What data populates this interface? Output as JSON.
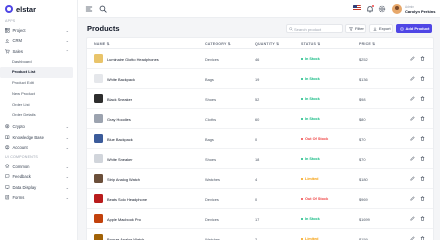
{
  "brand": {
    "name": "elstar"
  },
  "sidebar": {
    "apps_title": "APPS",
    "ui_title": "UI COMPONENTS",
    "items": [
      {
        "label": "Project",
        "icon": "grid-icon"
      },
      {
        "label": "CRM",
        "icon": "users-icon"
      },
      {
        "label": "Sales",
        "icon": "cart-icon"
      }
    ],
    "sales_sub": [
      "Dashboard",
      "Product List",
      "Product Edit",
      "New Product",
      "Order List",
      "Order Details"
    ],
    "more_items": [
      {
        "label": "Crypto",
        "icon": "crypto-icon"
      },
      {
        "label": "Knowledge Base",
        "icon": "book-icon"
      },
      {
        "label": "Account",
        "icon": "account-icon"
      }
    ],
    "ui_items": [
      {
        "label": "Common",
        "icon": "layers-icon"
      },
      {
        "label": "Feedback",
        "icon": "feedback-icon"
      },
      {
        "label": "Data Display",
        "icon": "display-icon"
      },
      {
        "label": "Forms",
        "icon": "forms-icon"
      }
    ]
  },
  "topbar": {
    "user_role": "Admin",
    "user_name": "Carolyn Perkins"
  },
  "page": {
    "title": "Products",
    "search_placeholder": "Search product",
    "filter_label": "Filter",
    "export_label": "Export",
    "add_label": "Add Product"
  },
  "table": {
    "headers": [
      "NAME",
      "CATEGORY",
      "QUANTITY",
      "STATUS",
      "PRICE"
    ],
    "rows": [
      {
        "name": "Luminaire Giotto Headphones",
        "category": "Devices",
        "qty": "46",
        "status": "In Stock",
        "price": "$252",
        "thumb": "#e9c46a"
      },
      {
        "name": "White Backpack",
        "category": "Bags",
        "qty": "19",
        "status": "In Stock",
        "price": "$136",
        "thumb": "#e5e7eb"
      },
      {
        "name": "Black Sneaker",
        "category": "Shoes",
        "qty": "52",
        "status": "In Stock",
        "price": "$98",
        "thumb": "#2d2d2d"
      },
      {
        "name": "Gray Hoodies",
        "category": "Cloths",
        "qty": "60",
        "status": "In Stock",
        "price": "$80",
        "thumb": "#9ca3af"
      },
      {
        "name": "Blue Backpack",
        "category": "Bags",
        "qty": "0",
        "status": "Out Of Stock",
        "price": "$70",
        "thumb": "#3b5b9a"
      },
      {
        "name": "White Sneaker",
        "category": "Shoes",
        "qty": "18",
        "status": "In Stock",
        "price": "$70",
        "thumb": "#d1d5db"
      },
      {
        "name": "Strip Analog Watch",
        "category": "Watches",
        "qty": "4",
        "status": "Limited",
        "price": "$180",
        "thumb": "#6b4f3a"
      },
      {
        "name": "Beats Solo Headphone",
        "category": "Devices",
        "qty": "0",
        "status": "Out Of Stock",
        "price": "$969",
        "thumb": "#b91c1c"
      },
      {
        "name": "Apple Macbook Pro",
        "category": "Devices",
        "qty": "17",
        "status": "In Stock",
        "price": "$1699",
        "thumb": "#c2410c"
      },
      {
        "name": "Bronze Analog Watch",
        "category": "Watches",
        "qty": "2",
        "status": "Limited",
        "price": "$159",
        "thumb": "#a16207"
      }
    ]
  },
  "colors": {
    "accent": "#4f46e5",
    "in_stock": "#10b981",
    "out_of_stock": "#ef4444",
    "limited": "#f59e0b"
  }
}
